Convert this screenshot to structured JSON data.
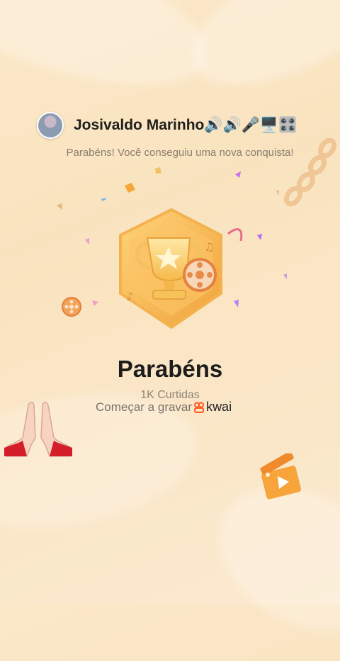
{
  "user": {
    "name": "Josivaldo Marinho🔊🔊🎤🖥️🎛️"
  },
  "subtitle": "Parabéns! Você conseguiu uma nova conquista!",
  "achievement": {
    "title": "Parabéns",
    "detail": "1K Curtidas"
  },
  "cta": {
    "label": "Começar a gravar",
    "brand": "kwai"
  },
  "icons": [
    "avatar",
    "trophy-badge-icon",
    "film-reel-icon",
    "praying-hands-icon",
    "clapperboard-icon",
    "kwai-logo-icon"
  ],
  "colors": {
    "background": "#fbe8c9",
    "badge": "#f5b94a",
    "brand": "#ff5a1f"
  }
}
